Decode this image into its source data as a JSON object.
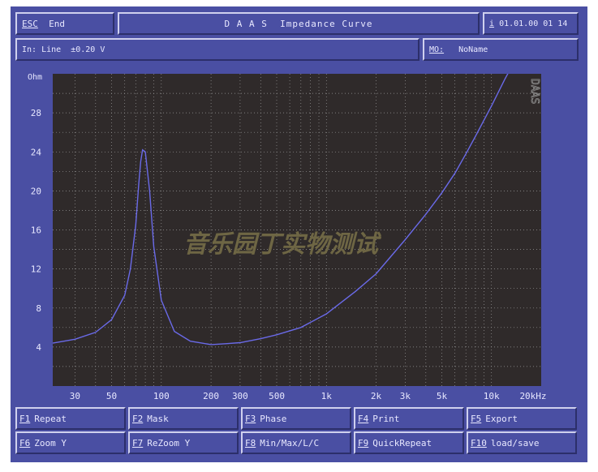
{
  "header": {
    "esc_key": "ESC",
    "esc_label": "End",
    "title": "D A A S  Impedance Curve",
    "info_key": "i",
    "datetime": "01.01.00 01 14"
  },
  "status": {
    "input_label": "In: Line",
    "input_level": "±0.20 V",
    "mo_key": "MO:",
    "mo_value": "NoName"
  },
  "watermark": "音乐园丁实物测试",
  "daas_logo": "DAAS",
  "function_keys": [
    {
      "key": "F1",
      "label": "Repeat"
    },
    {
      "key": "F2",
      "label": "Mask"
    },
    {
      "key": "F3",
      "label": "Phase"
    },
    {
      "key": "F4",
      "label": "Print"
    },
    {
      "key": "F5",
      "label": "Export"
    },
    {
      "key": "F6",
      "label": "Zoom Y"
    },
    {
      "key": "F7",
      "label": "ReZoom Y"
    },
    {
      "key": "F8",
      "label": "Min/Max/L/C"
    },
    {
      "key": "F9",
      "label": "QuickRepeat"
    },
    {
      "key": "F10",
      "label": "load/save"
    }
  ],
  "colors": {
    "screen_bg": "#4a4fa3",
    "plot_bg": "#2f2a2a",
    "grid": "#9a9a9a",
    "curve": "#6a6ae8",
    "text": "#e8e8ff",
    "watermark": "#6e6644"
  },
  "chart_data": {
    "type": "line",
    "title": "Impedance Curve",
    "xlabel": "",
    "ylabel": "Ohm",
    "x_scale": "log",
    "xlim": [
      22,
      20000
    ],
    "ylim": [
      0,
      32
    ],
    "grid": true,
    "y_ticks": [
      4,
      8,
      12,
      16,
      20,
      24,
      28
    ],
    "y_tick_labels": [
      "4",
      "8",
      "12",
      "16",
      "20",
      "24",
      "28"
    ],
    "y_unit_label": "Ohm",
    "x_ticks": [
      30,
      50,
      100,
      200,
      300,
      500,
      1000,
      2000,
      3000,
      5000,
      10000,
      20000
    ],
    "x_tick_labels": [
      "30",
      "50",
      "100",
      "200",
      "300",
      "500",
      "1k",
      "2k",
      "3k",
      "5k",
      "10k",
      "20kHz"
    ],
    "series": [
      {
        "x": [
          22,
          30,
          40,
          50,
          60,
          65,
          70,
          73,
          75,
          77,
          80,
          85,
          90,
          100,
          120,
          150,
          200,
          250,
          300,
          400,
          500,
          700,
          1000,
          1500,
          2000,
          3000,
          4000,
          5000,
          6000,
          7000,
          8000,
          10000,
          12000,
          14000
        ],
        "values": [
          4.4,
          4.8,
          5.5,
          6.8,
          9.3,
          12.0,
          16.5,
          20.7,
          23.0,
          24.2,
          24.0,
          20.0,
          14.3,
          8.8,
          5.6,
          4.6,
          4.25,
          4.35,
          4.45,
          4.85,
          5.25,
          6.0,
          7.4,
          9.7,
          11.5,
          15.0,
          17.6,
          19.8,
          21.8,
          23.8,
          25.6,
          28.7,
          31.4,
          33.5
        ]
      }
    ]
  }
}
